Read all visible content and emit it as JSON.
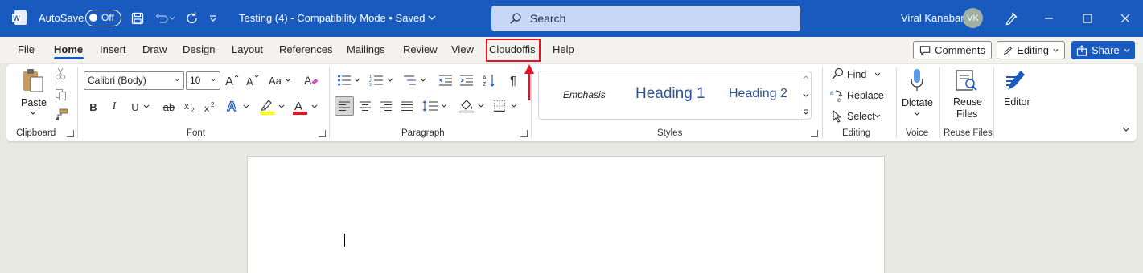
{
  "titlebar": {
    "autosave_label": "AutoSave",
    "autosave_state": "Off",
    "document_title": "Testing (4)  -  Compatibility Mode  •  Saved",
    "search_placeholder": "Search",
    "user_name": "Viral Kanabar",
    "user_initials": "VK"
  },
  "tabs": [
    "File",
    "Home",
    "Insert",
    "Draw",
    "Design",
    "Layout",
    "References",
    "Mailings",
    "Review",
    "View",
    "Cloudoffis",
    "Help"
  ],
  "active_tab": "Home",
  "highlighted_tab": "Cloudoffis",
  "right_actions": {
    "comments": "Comments",
    "editing": "Editing",
    "share": "Share"
  },
  "ribbon": {
    "clipboard": {
      "paste": "Paste",
      "group": "Clipboard"
    },
    "font": {
      "font_name": "Calibri (Body)",
      "font_size": "10",
      "group": "Font"
    },
    "paragraph": {
      "group": "Paragraph"
    },
    "styles": {
      "items": [
        "Emphasis",
        "Heading 1",
        "Heading 2"
      ],
      "group": "Styles"
    },
    "editing": {
      "find": "Find",
      "replace": "Replace",
      "select": "Select",
      "group": "Editing"
    },
    "voice": {
      "dictate": "Dictate",
      "group": "Voice"
    },
    "reuse": {
      "label_line1": "Reuse",
      "label_line2": "Files",
      "group": "Reuse Files"
    },
    "editor": {
      "label": "Editor"
    }
  },
  "colors": {
    "titlebar": "#185abd",
    "accent": "#185abd",
    "highlight": "#e81123",
    "highlight_color_bar": "#ffff00",
    "font_color_bar": "#e81123"
  }
}
